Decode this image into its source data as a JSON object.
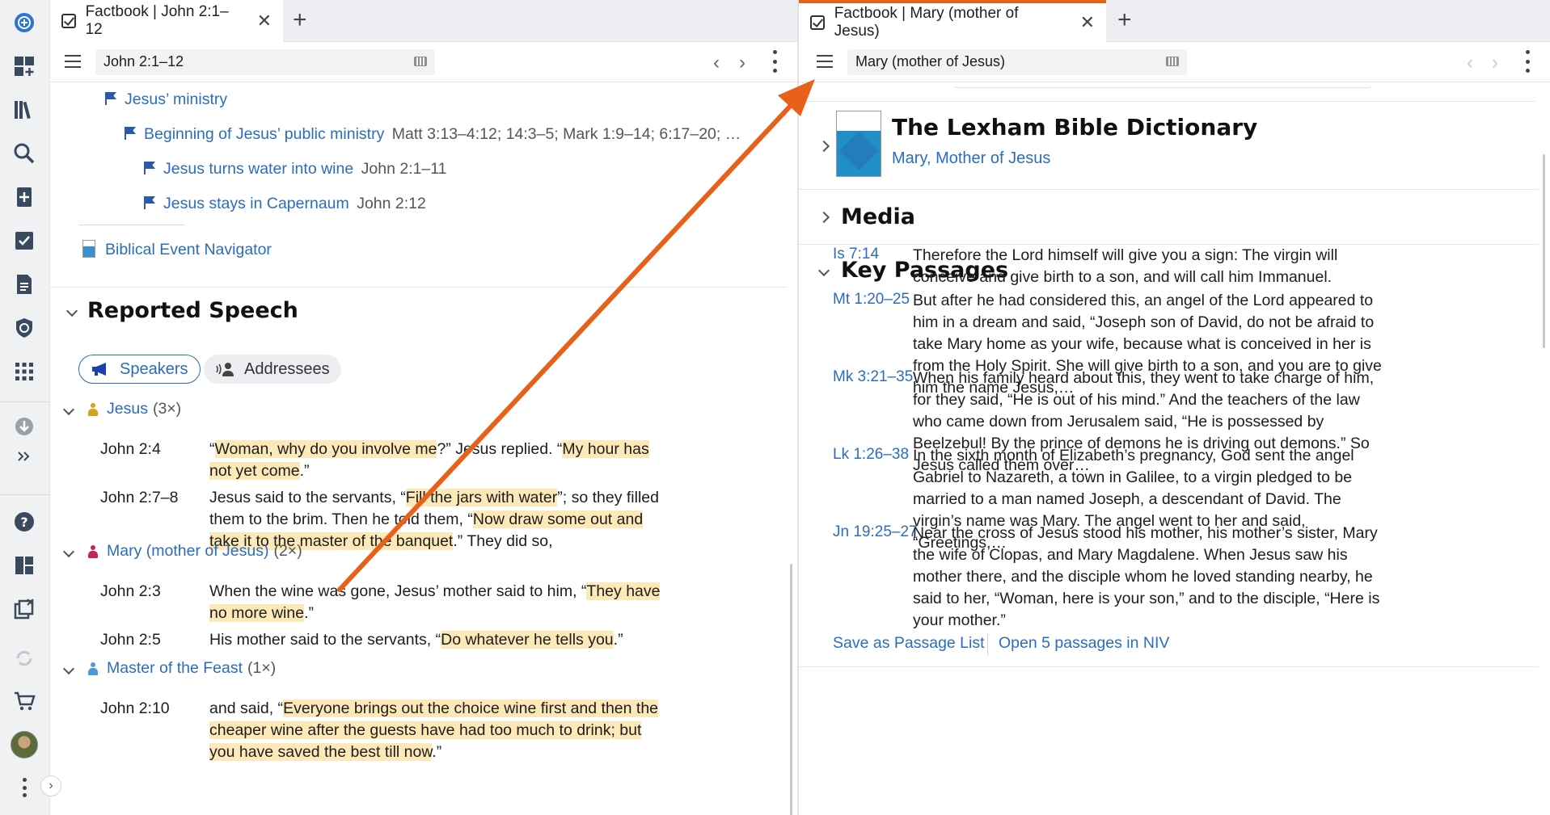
{
  "rail": {
    "icons": [
      "add-icon",
      "dashboard-plus-icon",
      "library-icon",
      "search-icon",
      "add-document-icon",
      "checklist-icon",
      "notes-icon",
      "shield-icon",
      "apps-grid-icon",
      "download-icon",
      "more-chevrons-icon",
      "help-icon",
      "layouts-icon",
      "close-panels-icon",
      "sync-icon",
      "cart-icon",
      "avatar",
      "kebab-icon"
    ]
  },
  "left_panel": {
    "tab": {
      "title": "Factbook | John 2:1–12"
    },
    "reference": "John 2:1–12",
    "events": [
      {
        "label": "Jesus’ ministry",
        "refs": ""
      },
      {
        "label": "Beginning of Jesus’ public ministry",
        "refs": "Matt 3:13–4:12; 14:3–5; Mark 1:9–14; 6:17–20; …"
      },
      {
        "label": "Jesus turns water into wine",
        "refs": "John 2:1–11"
      },
      {
        "label": "Jesus stays in Capernaum",
        "refs": "John 2:12"
      }
    ],
    "navigator": "Biblical Event Navigator",
    "reported_speech": {
      "heading": "Reported Speech",
      "tabs": [
        "Speakers",
        "Addressees"
      ],
      "groups": [
        {
          "name": "Jesus",
          "count": "(3×)",
          "color": "#d6a21a",
          "entries": [
            {
              "ref": "John 2:4",
              "parts": [
                {
                  "t": "“",
                  "h": false
                },
                {
                  "t": "Woman, why do you involve me",
                  "h": true
                },
                {
                  "t": "?” Jesus replied. “",
                  "h": false
                },
                {
                  "t": "My hour has not yet come",
                  "h": true
                },
                {
                  "t": ".”",
                  "h": false
                }
              ]
            },
            {
              "ref": "John 2:7–8",
              "parts": [
                {
                  "t": "Jesus said to the servants, “",
                  "h": false
                },
                {
                  "t": "Fill the jars with water",
                  "h": true
                },
                {
                  "t": "”; so they filled them to the brim. Then he told them, “",
                  "h": false
                },
                {
                  "t": "Now draw some out and take it to the master of the banquet",
                  "h": true
                },
                {
                  "t": ".” They did so,",
                  "h": false
                }
              ]
            }
          ]
        },
        {
          "name": "Mary (mother of Jesus)",
          "count": "(2×)",
          "color": "#c2265b",
          "entries": [
            {
              "ref": "John 2:3",
              "parts": [
                {
                  "t": "When the wine was gone, Jesus’ mother said to him, “",
                  "h": false
                },
                {
                  "t": "They have no more wine",
                  "h": true
                },
                {
                  "t": ".”",
                  "h": false
                }
              ]
            },
            {
              "ref": "John 2:5",
              "parts": [
                {
                  "t": "His mother said to the servants, “",
                  "h": false
                },
                {
                  "t": "Do whatever he tells you",
                  "h": true
                },
                {
                  "t": ".”",
                  "h": false
                }
              ]
            }
          ]
        },
        {
          "name": "Master of the Feast",
          "count": "(1×)",
          "color": "#4a9ad8",
          "entries": [
            {
              "ref": "John 2:10",
              "parts": [
                {
                  "t": "and said, “",
                  "h": false
                },
                {
                  "t": "Everyone brings out the choice wine first and then the cheaper wine after the guests have had too much to drink; but you have saved the best till now",
                  "h": true
                },
                {
                  "t": ".”",
                  "h": false
                }
              ]
            }
          ]
        }
      ]
    }
  },
  "right_panel": {
    "tab": {
      "title": "Factbook | Mary (mother of Jesus)"
    },
    "reference": "Mary (mother of Jesus)",
    "resource": {
      "title": "The Lexham Bible Dictionary",
      "article": "Mary, Mother of Jesus"
    },
    "media_heading": "Media",
    "key_passages": {
      "heading": "Key Passages",
      "items": [
        {
          "ref": "Is 7:14",
          "text": "Therefore the Lord himself will give you a sign: The virgin will conceive and give birth to a son, and will call him Immanuel."
        },
        {
          "ref": "Mt 1:20–25",
          "text": "But after he had considered this, an angel of the Lord appeared to him in a dream and said, “Joseph son of David, do not be afraid to take Mary home as your wife, because what is conceived in her is from the Holy Spirit. She will give birth to a son, and you are to give him the name Jesus,…"
        },
        {
          "ref": "Mk 3:21–35",
          "text": "When his family heard about this, they went to take charge of him, for they said, “He is out of his mind.” And the teachers of the law who came down from Jerusalem said, “He is possessed by Beelzebul! By the prince of demons he is driving out demons.” So Jesus called them over…"
        },
        {
          "ref": "Lk 1:26–38",
          "text": "In the sixth month of Elizabeth’s pregnancy, God sent the angel Gabriel to Nazareth, a town in Galilee, to a virgin pledged to be married to a man named Joseph, a descendant of David. The virgin’s name was Mary. The angel went to her and said, “Greetings,…"
        },
        {
          "ref": "Jn 19:25–27",
          "text": "Near the cross of Jesus stood his mother, his mother’s sister, Mary the wife of Clopas, and Mary Magdalene. When Jesus saw his mother there, and the disciple whom he loved standing nearby, he said to her, “Woman, here is your son,” and to the disciple, “Here is your mother.”"
        }
      ],
      "actions": [
        "Save as Passage List",
        "Open 5 passages in NIV"
      ]
    }
  },
  "colors": {
    "accent": "#2b6cbf",
    "highlight": "#fde8b8",
    "arrow": "#e8611a"
  }
}
